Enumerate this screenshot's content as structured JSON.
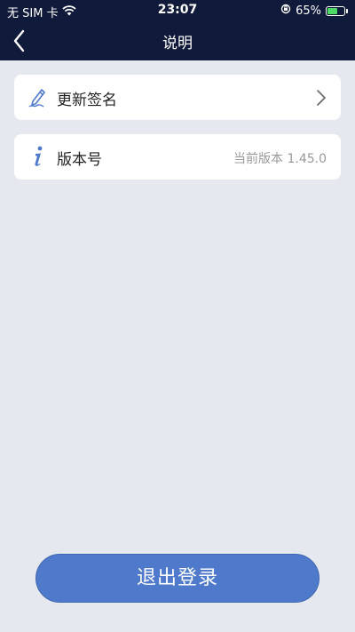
{
  "status_bar": {
    "carrier": "无 SIM 卡",
    "time": "23:07",
    "battery": "65%",
    "battery_level": 0.65
  },
  "nav": {
    "title": "说明"
  },
  "items": [
    {
      "label": "更新签名",
      "icon": "signature-pen-icon",
      "action": "chevron-right-icon"
    },
    {
      "label": "版本号",
      "icon": "info-icon",
      "value": "当前版本 1.45.0"
    }
  ],
  "logout_label": "退出登录",
  "colors": {
    "header": "#101a3a",
    "background": "#e5e8ef",
    "accent": "#4f79cb",
    "battery_fill": "#4cd964"
  }
}
